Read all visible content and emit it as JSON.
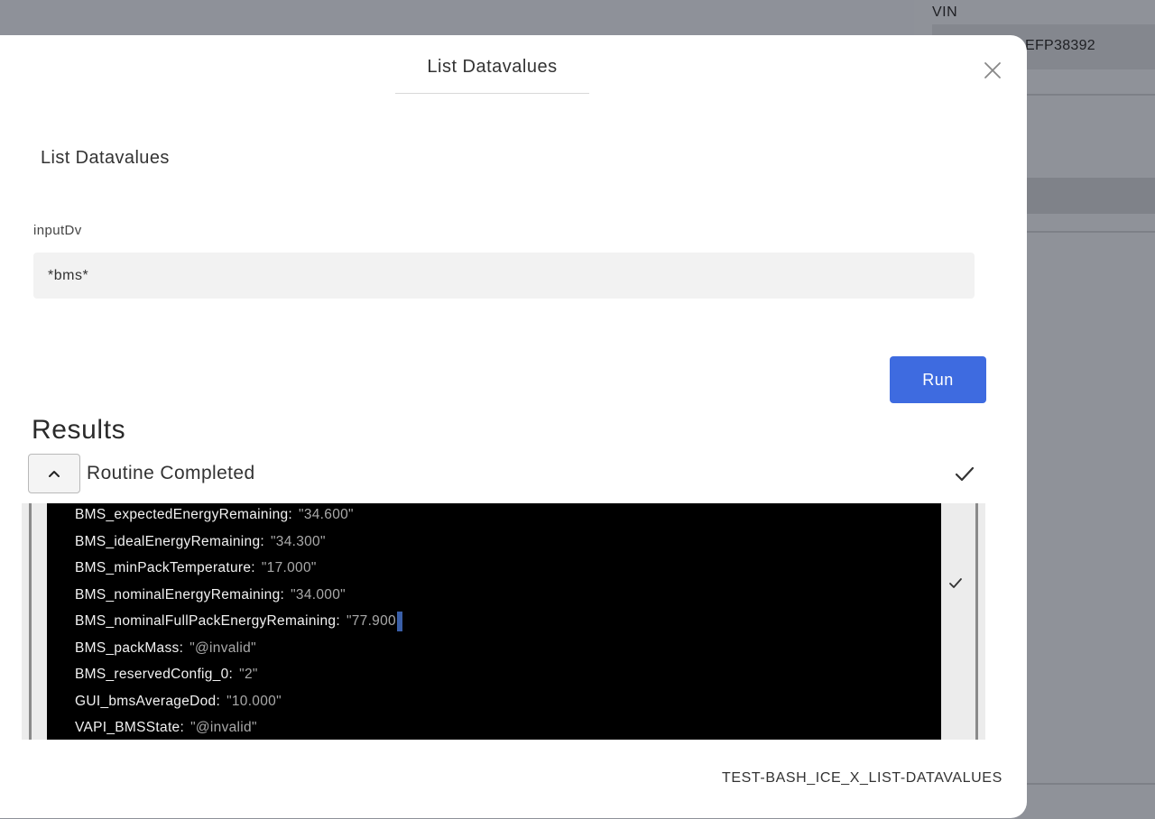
{
  "background": {
    "vin_label": "VIN",
    "vin_value": "EFP38392"
  },
  "modal": {
    "title": "List Datavalues",
    "subtitle": "List Datavalues",
    "input": {
      "label": "inputDv",
      "value": "*bms*"
    },
    "run_label": "Run",
    "results_heading": "Results",
    "routine_status": "Routine Completed",
    "results": [
      {
        "key": "BMS_expectedEnergyRemaining:",
        "value": "\"34.600\""
      },
      {
        "key": "BMS_idealEnergyRemaining:",
        "value": "\"34.300\""
      },
      {
        "key": "BMS_minPackTemperature:",
        "value": "\"17.000\""
      },
      {
        "key": "BMS_nominalEnergyRemaining:",
        "value": "\"34.000\""
      },
      {
        "key": "BMS_nominalFullPackEnergyRemaining:",
        "value": "\"77.900"
      },
      {
        "key": "BMS_packMass:",
        "value": "\"@invalid\""
      },
      {
        "key": "BMS_reservedConfig_0:",
        "value": "\"2\""
      },
      {
        "key": "GUI_bmsAverageDod:",
        "value": "\"10.000\""
      },
      {
        "key": "VAPI_BMSState:",
        "value": "\"@invalid\""
      }
    ],
    "footer_id": "TEST-BASH_ICE_X_LIST-DATAVALUES"
  },
  "icons": {
    "close": "close-icon",
    "collapse": "chevron-up-icon",
    "status": "check-icon"
  },
  "colors": {
    "accent": "#3e6be0",
    "overlay": "#8e9199",
    "terminal_bg": "#000000"
  }
}
